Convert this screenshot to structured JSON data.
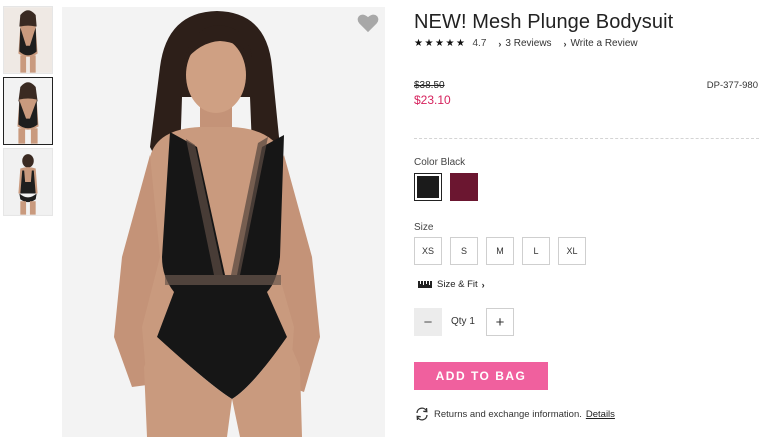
{
  "product": {
    "title": "NEW! Mesh Plunge Bodysuit",
    "rating": "4.7",
    "stars": [
      "★",
      "★",
      "★",
      "★",
      "★"
    ],
    "reviews_link": "3 Reviews",
    "write_review_link": "Write a Review",
    "original_price": "$38.50",
    "sale_price": "$23.10",
    "sku": "DP-377-980"
  },
  "color": {
    "label": "Color Black",
    "swatches": [
      {
        "name": "Black",
        "hex": "#1b1b1b",
        "selected": true
      },
      {
        "name": "Burgundy",
        "hex": "#6b1630",
        "selected": false
      }
    ]
  },
  "size": {
    "label": "Size",
    "options": [
      "XS",
      "S",
      "M",
      "L",
      "XL"
    ]
  },
  "size_fit": {
    "label": "Size & Fit",
    "icon": "ruler-icon"
  },
  "quantity": {
    "minus_label": "−",
    "label": "Qty 1",
    "plus_label": "+"
  },
  "cta": {
    "add_to_bag": "ADD TO BAG",
    "color": "#f0609e"
  },
  "returns": {
    "text": "Returns and exchange information.",
    "details_link": "Details",
    "icon": "refresh-icon"
  },
  "icons": {
    "favorite": "heart-icon"
  },
  "colors": {
    "sale_price": "#d6225d",
    "accent": "#f0609e"
  }
}
